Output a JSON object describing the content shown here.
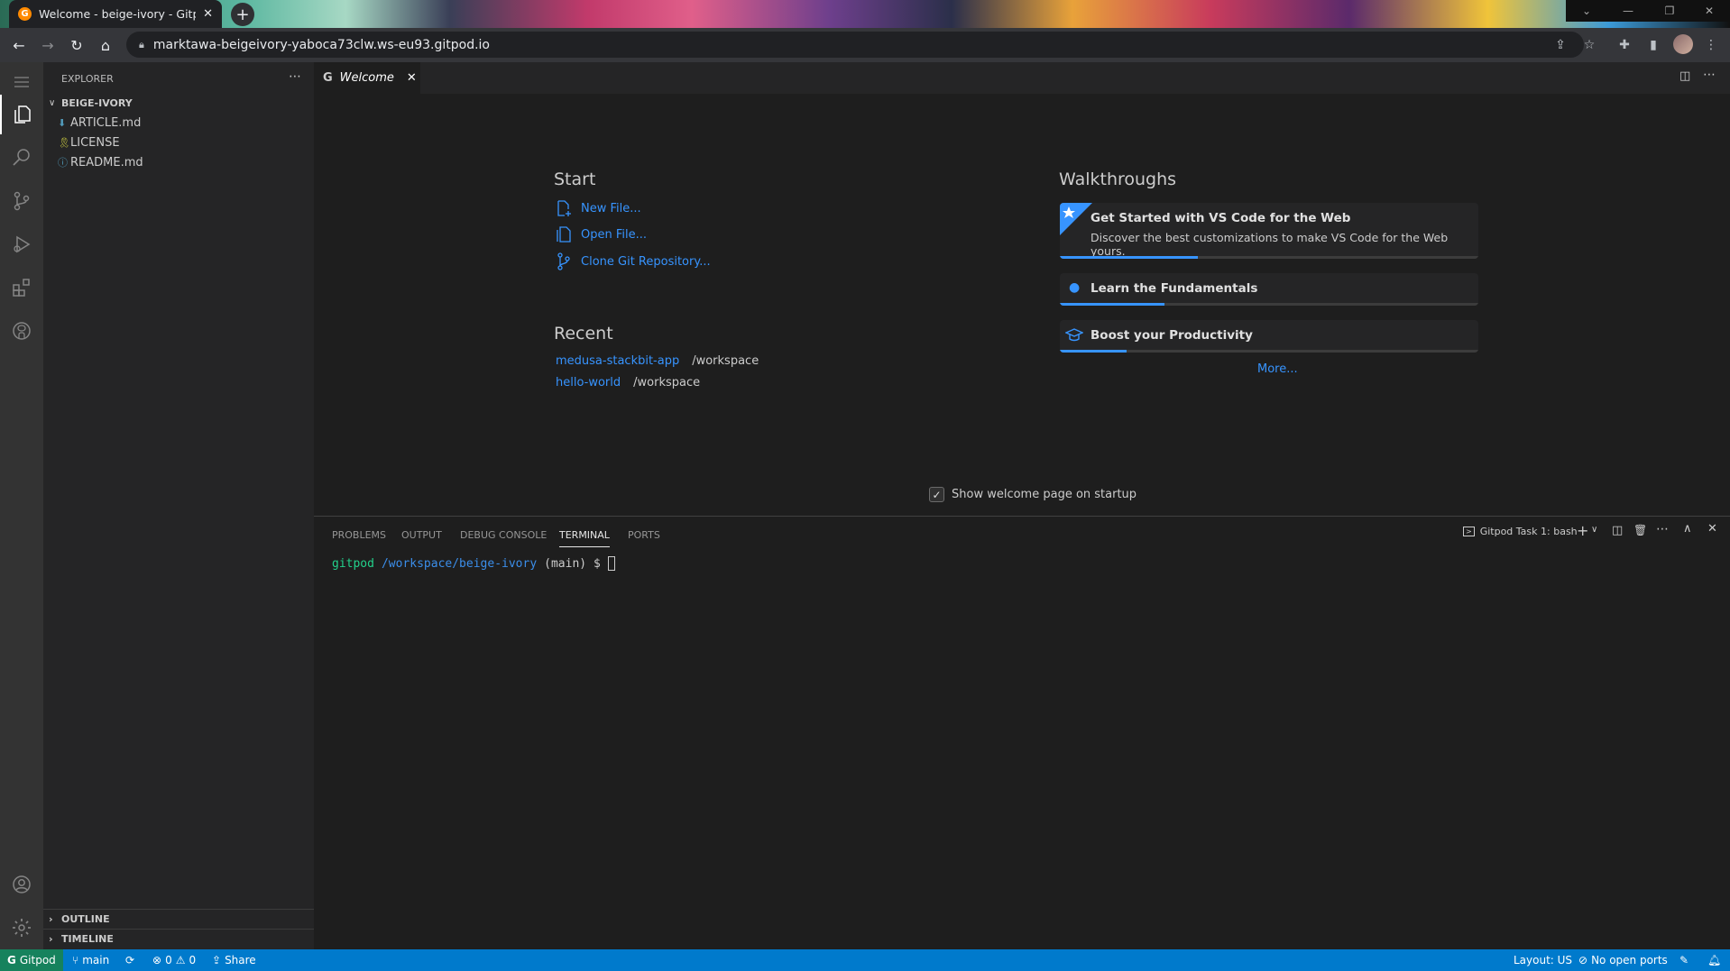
{
  "browser": {
    "tab_title": "Welcome - beige-ivory - Gitpod",
    "url": "marktawa-beigeivory-yaboca73clw.ws-eu93.gitpod.io"
  },
  "editor_tab": {
    "label": "Welcome"
  },
  "explorer": {
    "header": "EXPLORER",
    "root": "BEIGE-IVORY",
    "files": [
      {
        "name": "ARTICLE.md",
        "icon": "markdown-icon",
        "color": "#519aba"
      },
      {
        "name": "LICENSE",
        "icon": "license-icon",
        "color": "#cbcb41"
      },
      {
        "name": "README.md",
        "icon": "info-icon",
        "color": "#519aba"
      }
    ],
    "outline": "OUTLINE",
    "timeline": "TIMELINE"
  },
  "welcome": {
    "start_heading": "Start",
    "start_items": [
      "New File...",
      "Open File...",
      "Clone Git Repository..."
    ],
    "recent_heading": "Recent",
    "recent": [
      {
        "name": "medusa-stackbit-app",
        "path": "/workspace"
      },
      {
        "name": "hello-world",
        "path": "/workspace"
      }
    ],
    "walkthroughs_heading": "Walkthroughs",
    "walkthroughs": [
      {
        "title": "Get Started with VS Code for the Web",
        "description": "Discover the best customizations to make VS Code for the Web yours.",
        "progress": 0.33
      },
      {
        "title": "Learn the Fundamentals",
        "progress": 0.25
      },
      {
        "title": "Boost your Productivity",
        "progress": 0.2
      }
    ],
    "more": "More...",
    "startup_checkbox": "Show welcome page on startup",
    "startup_checked": true
  },
  "panel": {
    "tabs": [
      "PROBLEMS",
      "OUTPUT",
      "DEBUG CONSOLE",
      "TERMINAL",
      "PORTS"
    ],
    "active_tab": "TERMINAL",
    "terminal_name": "Gitpod Task 1: bash",
    "prompt_user": "gitpod",
    "prompt_path": "/workspace/beige-ivory",
    "prompt_branch": "(main) $"
  },
  "statusbar": {
    "gitpod": "Gitpod",
    "branch": "main",
    "errors": "0",
    "warnings": "0",
    "share": "Share",
    "layout": "Layout: US",
    "ports": "No open ports"
  },
  "colors": {
    "accent": "#007acc",
    "link": "#3794ff"
  }
}
